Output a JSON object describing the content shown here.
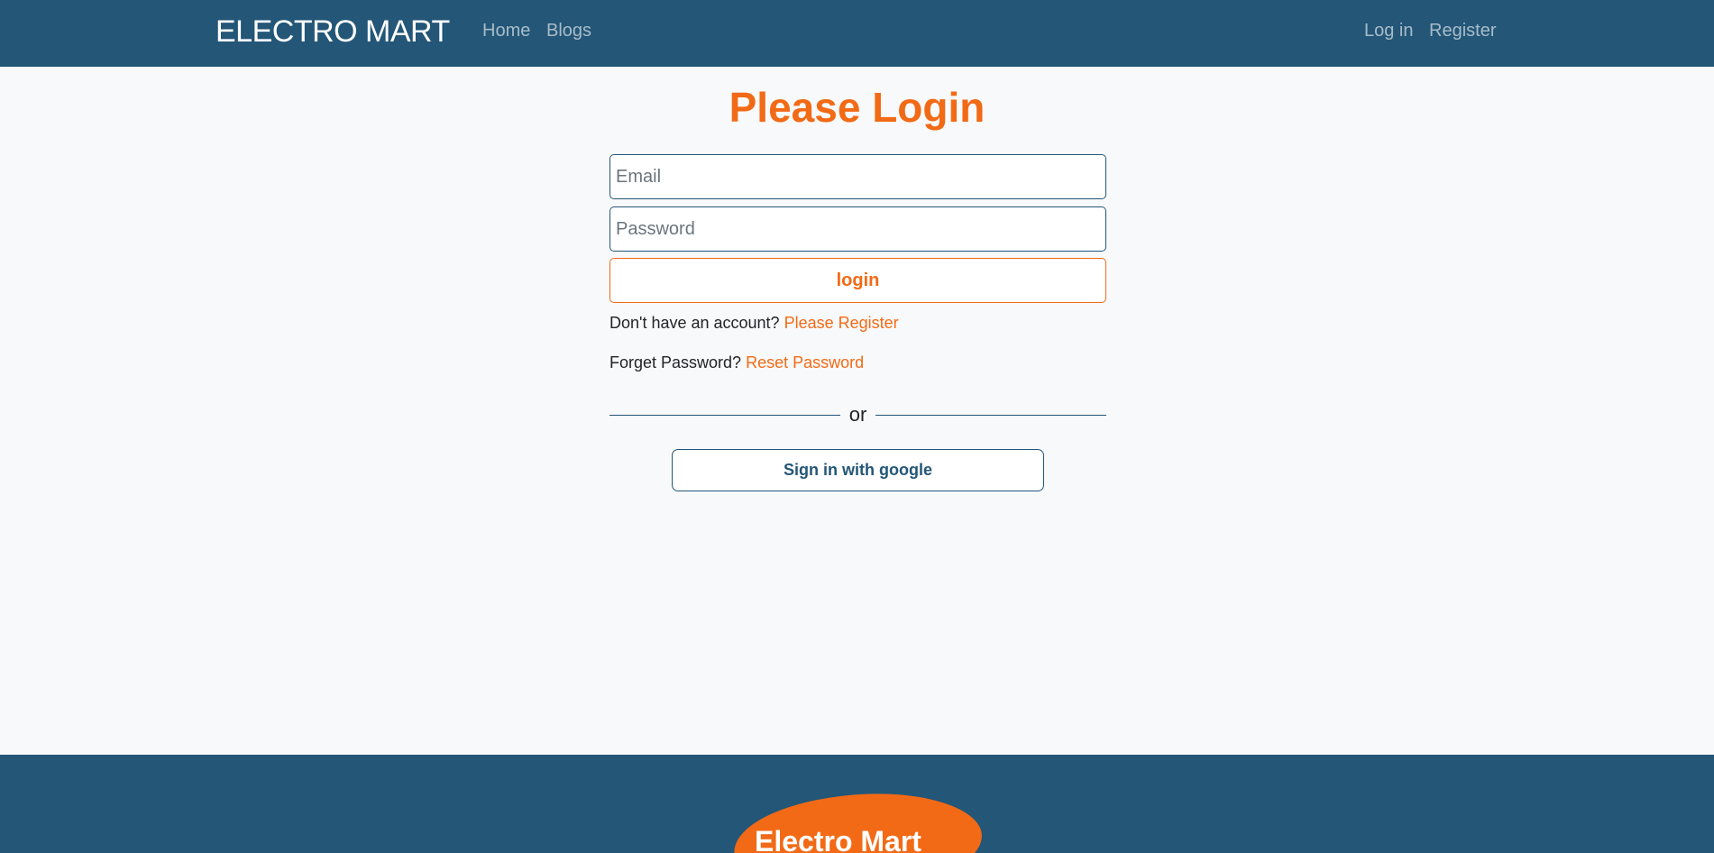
{
  "navbar": {
    "brand": "ELECTRO MART",
    "links": [
      {
        "label": "Home"
      },
      {
        "label": "Blogs"
      }
    ],
    "auth_links": [
      {
        "label": "Log in"
      },
      {
        "label": "Register"
      }
    ]
  },
  "login": {
    "title": "Please Login",
    "email_placeholder": "Email",
    "password_placeholder": "Password",
    "submit_label": "login",
    "register_prompt": "Don't have an account?",
    "register_link": "Please Register",
    "forgot_prompt": "Forget Password?",
    "reset_link": "Reset Password",
    "divider_text": "or",
    "google_label": "Sign in with google"
  },
  "footer": {
    "logo_text": "Electro Mart"
  },
  "colors": {
    "primary": "#235677",
    "accent": "#f26a16",
    "background": "#f8f9fa"
  }
}
